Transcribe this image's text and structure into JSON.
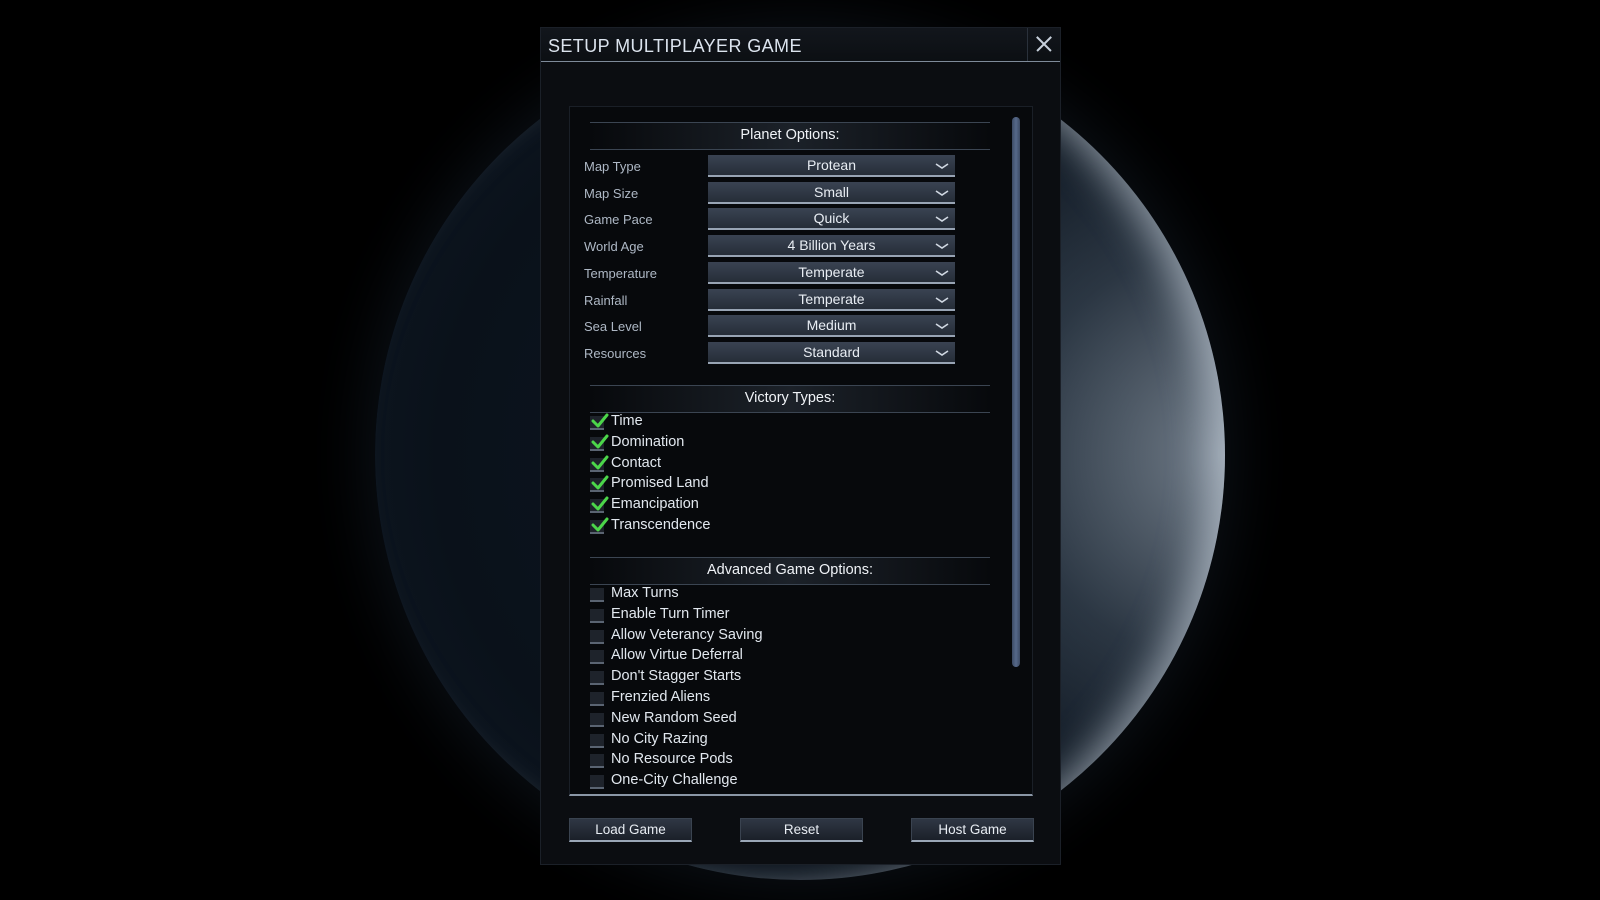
{
  "dialog": {
    "title": "SETUP MULTIPLAYER GAME",
    "close_icon": "close-icon"
  },
  "planet_options": {
    "header": "Planet Options:",
    "rows": [
      {
        "label": "Map Type",
        "value": "Protean"
      },
      {
        "label": "Map Size",
        "value": "Small"
      },
      {
        "label": "Game Pace",
        "value": "Quick"
      },
      {
        "label": "World Age",
        "value": "4 Billion Years"
      },
      {
        "label": "Temperature",
        "value": "Temperate"
      },
      {
        "label": "Rainfall",
        "value": "Temperate"
      },
      {
        "label": "Sea Level",
        "value": "Medium"
      },
      {
        "label": "Resources",
        "value": "Standard"
      }
    ]
  },
  "victory_types": {
    "header": "Victory Types:",
    "items": [
      {
        "label": "Time",
        "checked": true
      },
      {
        "label": "Domination",
        "checked": true
      },
      {
        "label": "Contact",
        "checked": true
      },
      {
        "label": "Promised Land",
        "checked": true
      },
      {
        "label": "Emancipation",
        "checked": true
      },
      {
        "label": "Transcendence",
        "checked": true
      }
    ]
  },
  "advanced_options": {
    "header": "Advanced Game Options:",
    "items": [
      {
        "label": "Max Turns",
        "checked": false
      },
      {
        "label": "Enable Turn Timer",
        "checked": false
      },
      {
        "label": "Allow Veterancy Saving",
        "checked": false
      },
      {
        "label": "Allow Virtue Deferral",
        "checked": false
      },
      {
        "label": "Don't Stagger Starts",
        "checked": false
      },
      {
        "label": "Frenzied Aliens",
        "checked": false
      },
      {
        "label": "New Random Seed",
        "checked": false
      },
      {
        "label": "No City Razing",
        "checked": false
      },
      {
        "label": "No Resource Pods",
        "checked": false
      },
      {
        "label": "One-City Challenge",
        "checked": false
      }
    ]
  },
  "footer": {
    "load_label": "Load Game",
    "reset_label": "Reset",
    "host_label": "Host Game"
  },
  "colors": {
    "accent_check": "#4cd64a",
    "dialog_bg": "#0b0d11",
    "scrollbar": "#56698a"
  }
}
